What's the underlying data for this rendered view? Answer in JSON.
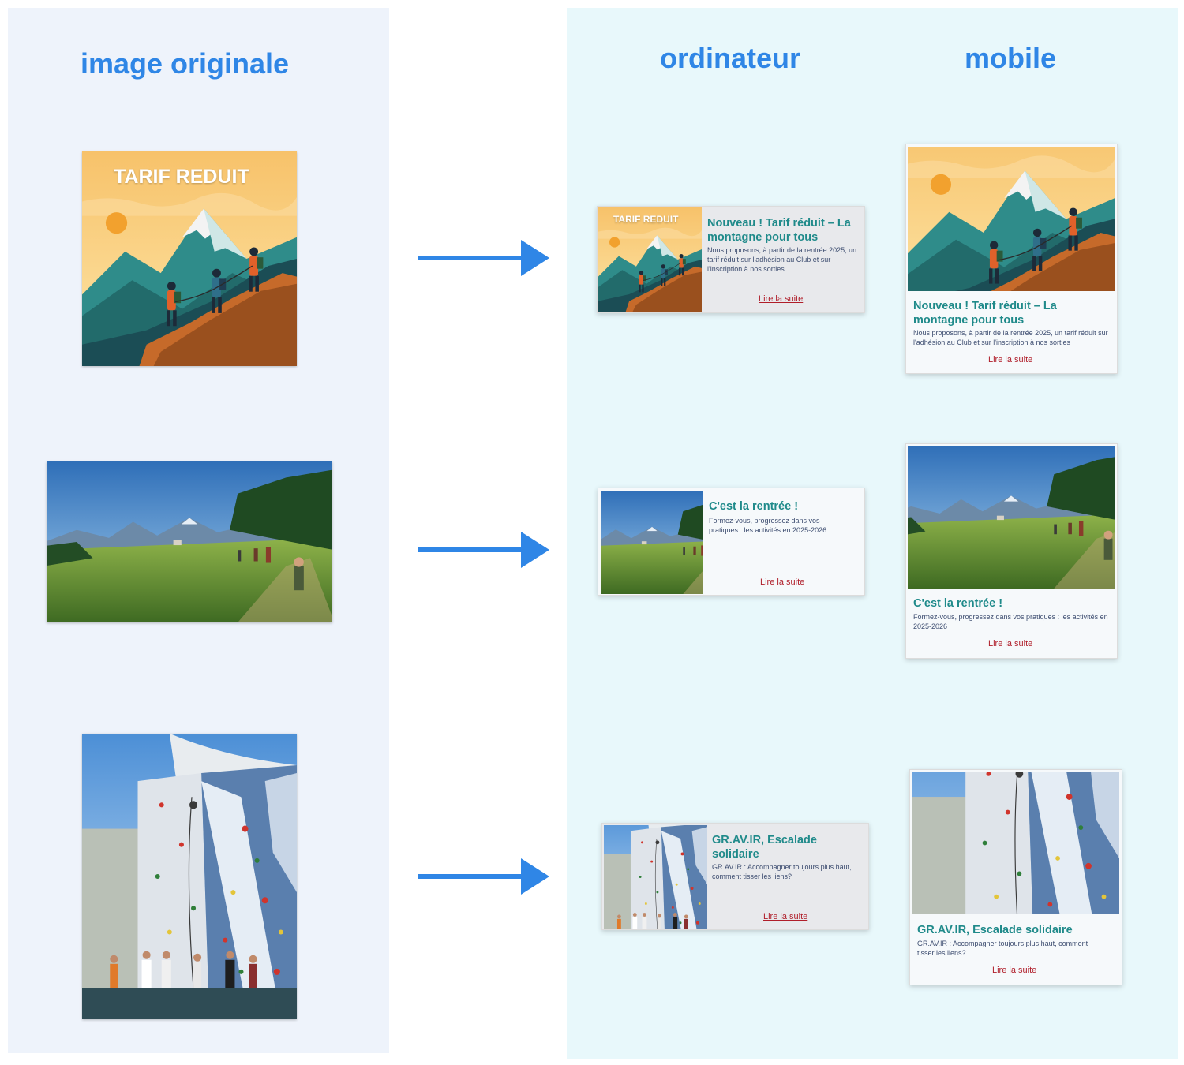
{
  "headings": {
    "original": "image originale",
    "desktop": "ordinateur",
    "mobile": "mobile"
  },
  "original_images": [
    {
      "caption": "TARIF REDUIT",
      "icon": "mountain-hikers-illustration"
    },
    {
      "icon": "mountain-meadow-photo"
    },
    {
      "icon": "climbing-wall-photo"
    }
  ],
  "cards": [
    {
      "image_caption": "TARIF REDUIT",
      "title": "Nouveau ! Tarif réduit – La montagne pour tous",
      "desktop_description": "Nous proposons, à partir de la rentrée 2025, un tarif réduit sur l'adhésion au Club et sur l'inscription à nos sorties",
      "mobile_description": "Nous proposons, à partir de la rentrée 2025, un tarif réduit sur l'adhésion au Club et sur l'inscription à nos sorties",
      "link": "Lire la suite"
    },
    {
      "title": "C'est la rentrée !",
      "desktop_description": "Formez-vous, progressez dans vos pratiques : les activités en 2025-2026",
      "mobile_description": "Formez-vous, progressez dans vos pratiques : les activités en 2025-2026",
      "link": "Lire la suite"
    },
    {
      "title": "GR.AV.IR, Escalade solidaire",
      "desktop_description": "GR.AV.IR : Accompagner toujours plus haut, comment tisser les liens?",
      "mobile_description": "GR.AV.IR : Accompagner toujours plus haut, comment tisser les liens?",
      "link": "Lire la suite"
    }
  ],
  "colors": {
    "heading": "#2f86e6",
    "arrow": "#2f86e6",
    "title": "#1f8a8a",
    "description": "#3d4d70",
    "link": "#b01e2a",
    "left_panel": "#eef3fb",
    "right_panel": "#e8f8fb"
  }
}
